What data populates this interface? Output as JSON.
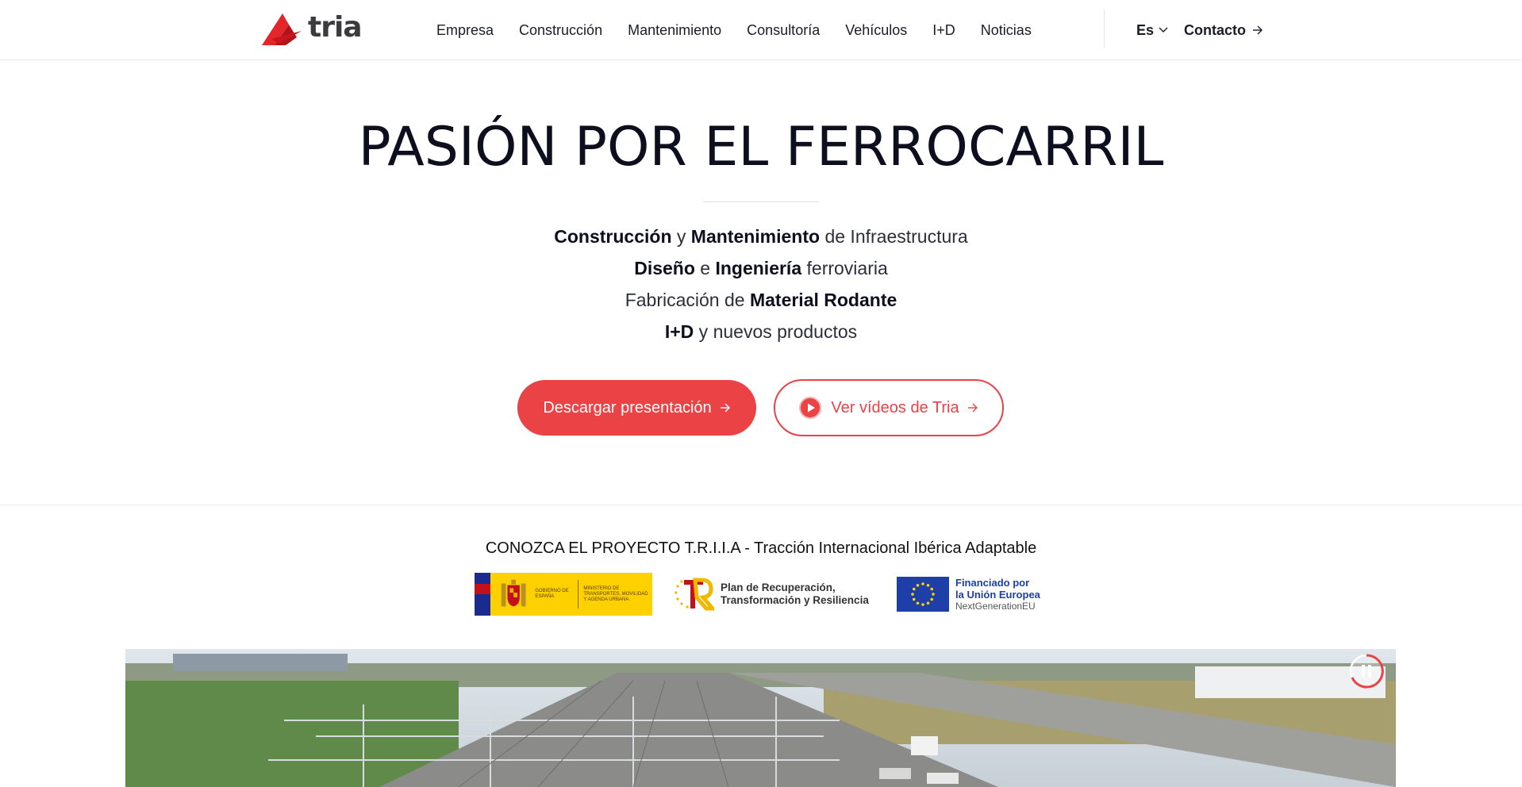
{
  "header": {
    "logo_text": "tria",
    "nav": [
      "Empresa",
      "Construcción",
      "Mantenimiento",
      "Consultoría",
      "Vehículos",
      "I+D",
      "Noticias"
    ],
    "language": "Es",
    "contact_label": "Contacto"
  },
  "hero": {
    "title": "PASIÓN POR EL FERROCARRIL",
    "line1": {
      "b1": "Construcción",
      "t1": " y ",
      "b2": "Mantenimiento",
      "t2": " de Infraestructura"
    },
    "line2": {
      "b1": "Diseño",
      "t1": " e ",
      "b2": "Ingeniería",
      "t2": " ferroviaria"
    },
    "line3": {
      "t1": "Fabricación de ",
      "b1": "Material Rodante"
    },
    "line4": {
      "b1": "I+D",
      "t1": " y nuevos productos"
    },
    "primary_button": "Descargar presentación",
    "secondary_button": "Ver vídeos de Tria"
  },
  "project": {
    "title": "CONOZCA EL PROYECTO T.R.I.I.A - Tracción Internacional Ibérica Adaptable",
    "spain_gov": "GOBIERNO DE ESPAÑA",
    "spain_ministry": "MINISTERIO DE TRANSPORTES, MOVILIDAD Y AGENDA URBANA",
    "prtr_line1": "Plan de Recuperación,",
    "prtr_line2": "Transformación y Resiliencia",
    "eu_line1": "Financiado por",
    "eu_line2": "la Unión Europea",
    "eu_line3": "NextGenerationEU"
  },
  "colors": {
    "accent": "#ea4245",
    "text": "#0d0f1e"
  }
}
